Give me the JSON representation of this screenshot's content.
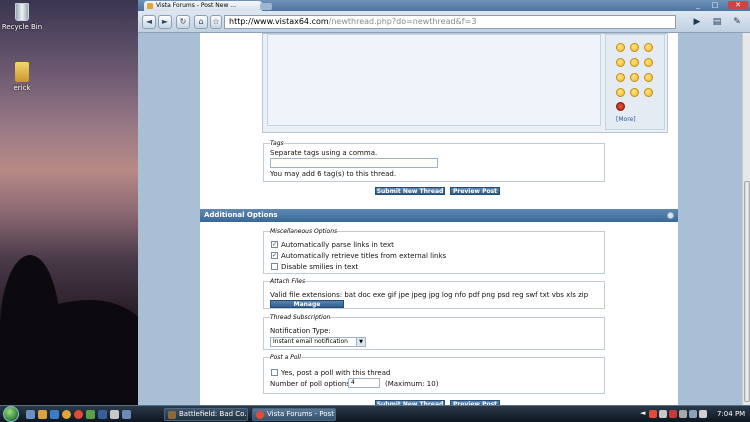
{
  "desktop": {
    "icons": [
      {
        "label": "Recycle Bin"
      },
      {
        "label": "erick"
      }
    ]
  },
  "browser": {
    "tab_title": "Vista Forums - Post New ...",
    "url_host": "http://www.vistax64.com",
    "url_path": "/newthread.php?do=newthread&f=3",
    "window_controls": {
      "minimize": "_",
      "maximize": "□",
      "close": "✕"
    }
  },
  "page": {
    "smilies_more": "[More]",
    "tags": {
      "legend": "Tags",
      "hint": "Separate tags using a comma.",
      "input_value": "",
      "note": "You may add 6 tag(s) to this thread."
    },
    "buttons": {
      "submit": "Submit New Thread",
      "preview": "Preview Post"
    },
    "additional_options": {
      "title": "Additional Options",
      "misc": {
        "legend": "Miscellaneous Options",
        "options": [
          {
            "label": "Automatically parse links in text",
            "checked": true
          },
          {
            "label": "Automatically retrieve titles from external links",
            "checked": true
          },
          {
            "label": "Disable smilies in text",
            "checked": false
          }
        ]
      },
      "attach": {
        "legend": "Attach Files",
        "text": "Valid file extensions: bat doc exe gif jpe jpeg jpg log nfo pdf png psd reg swf txt vbs xls zip",
        "button": "Manage Attachments"
      },
      "subscription": {
        "legend": "Thread Subscription",
        "label": "Notification Type:",
        "selected": "Instant email notification"
      },
      "poll": {
        "legend": "Post a Poll",
        "checkbox_label": "Yes, post a poll with this thread",
        "checked": false,
        "options_label": "Number of poll options:",
        "options_value": "4",
        "max": "(Maximum: 10)"
      }
    }
  },
  "taskbar": {
    "tasks": [
      {
        "label": "Battlefield: Bad Co..."
      },
      {
        "label": "Vista Forums - Post ..."
      }
    ],
    "clock": "7:04 PM"
  }
}
